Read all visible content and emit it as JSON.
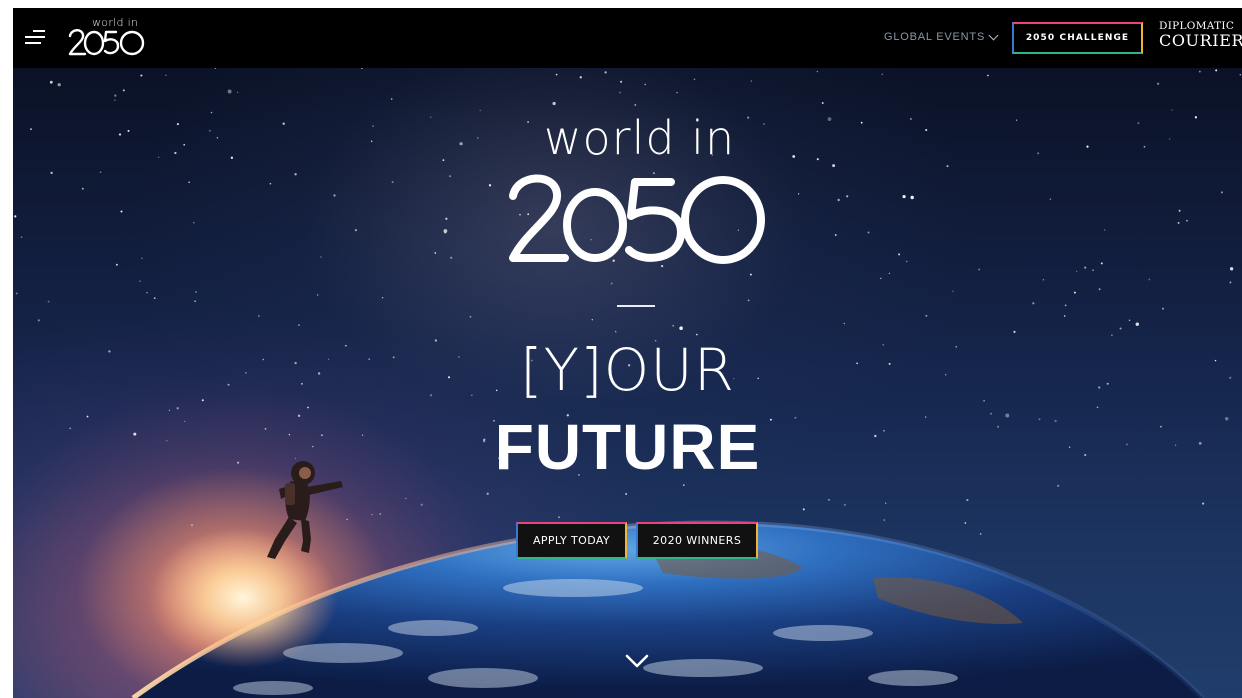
{
  "header": {
    "menu_icon": "hamburger-menu-icon",
    "logo": {
      "top": "world in",
      "bottom": "2050"
    },
    "nav_events_label": "GLOBAL EVENTS",
    "nav_events_icon": "chevron-down-icon",
    "challenge_label": "2050 CHALLENGE",
    "partner_logo": {
      "line1": "DIPLOMATIC",
      "line2": "COURIER"
    }
  },
  "hero": {
    "logo_top": "world in",
    "logo_bottom": "2050",
    "tagline_line1": "[Y]OUR",
    "tagline_line2": "FUTURE",
    "apply_label": "APPLY TODAY",
    "winners_label": "2020 WINNERS",
    "scroll_icon": "chevron-down-icon"
  },
  "colors": {
    "button_border_top": "#e8437a",
    "button_border_left": "#3a78d6",
    "button_border_bottom": "#2fb58a",
    "button_border_right": "#f2b233",
    "header_bg": "#000000",
    "nav_text": "#8a97a8"
  }
}
